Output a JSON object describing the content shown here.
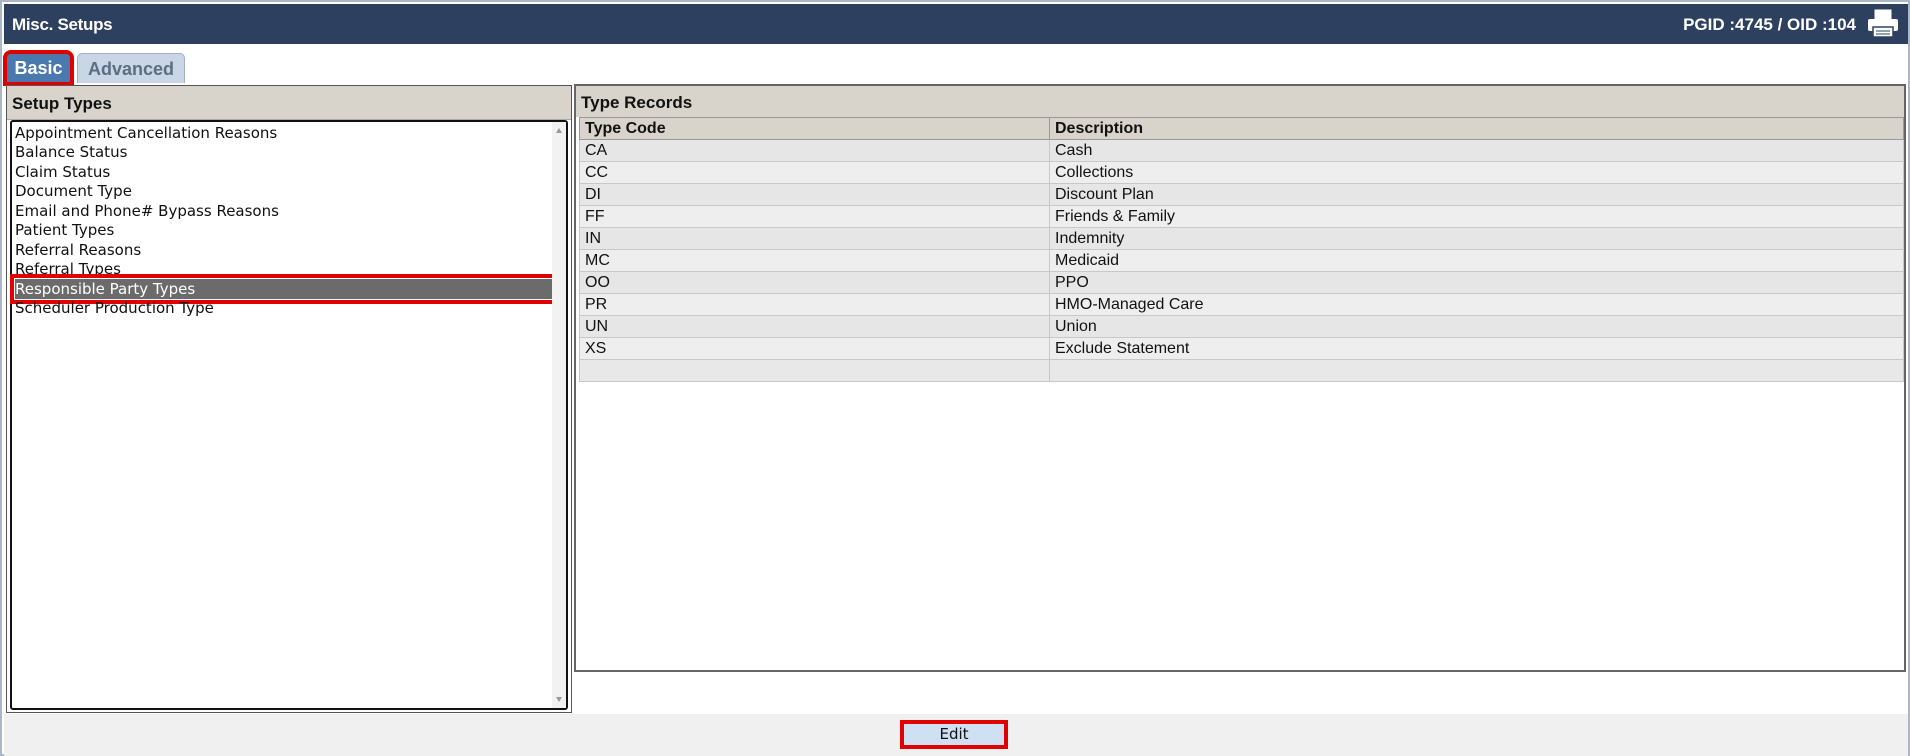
{
  "window": {
    "title": "Misc. Setups",
    "ids": "PGID :4745  /  OID :104",
    "printer_icon": "printer-icon"
  },
  "tabs": [
    {
      "label": "Basic",
      "active": true
    },
    {
      "label": "Advanced",
      "active": false
    }
  ],
  "setup_types": {
    "heading": "Setup Types",
    "items": [
      "Appointment Cancellation Reasons",
      "Balance Status",
      "Claim Status",
      "Document Type",
      "Email and Phone# Bypass Reasons",
      "Patient Types",
      "Referral Reasons",
      "Referral Types",
      "Responsible Party Types",
      "Scheduler Production Type"
    ],
    "selected_index": 8
  },
  "type_records": {
    "heading": "Type Records",
    "columns": [
      "Type Code",
      "Description"
    ],
    "rows": [
      [
        "CA",
        "Cash"
      ],
      [
        "CC",
        "Collections"
      ],
      [
        "DI",
        "Discount Plan"
      ],
      [
        "FF",
        "Friends & Family"
      ],
      [
        "IN",
        "Indemnity"
      ],
      [
        "MC",
        "Medicaid"
      ],
      [
        "OO",
        "PPO"
      ],
      [
        "PR",
        "HMO-Managed Care"
      ],
      [
        "UN",
        "Union"
      ],
      [
        "XS",
        "Exclude Statement"
      ],
      [
        "",
        ""
      ]
    ]
  },
  "footer": {
    "edit_label": "Edit"
  },
  "colors": {
    "titlebar": "#2e4060",
    "highlight": "#e00000",
    "selected_row": "#6b6b6b"
  }
}
